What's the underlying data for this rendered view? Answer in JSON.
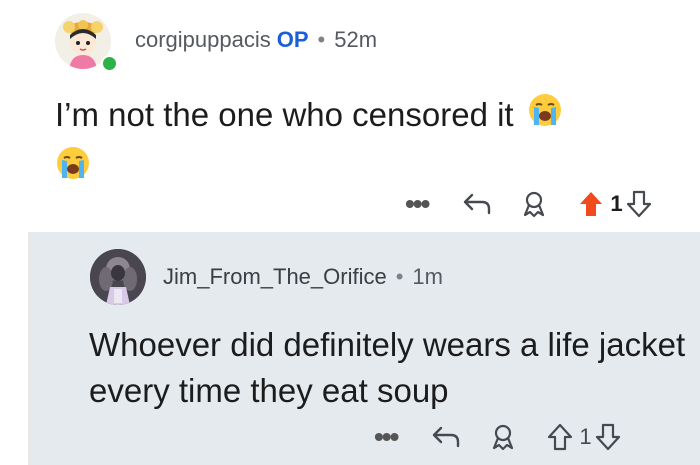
{
  "comment_op": {
    "author": "corgipuppacis",
    "flair": "OP",
    "separator": "•",
    "time": "52m",
    "body_line1": "I’m not the one who censored it",
    "emoji_name": "loudly-crying-face-emoji",
    "more_label": "•••",
    "vote_count": "1",
    "upvote_color": "#f14b1d"
  },
  "comment_reply": {
    "author": "Jim_From_The_Orifice",
    "separator": "•",
    "time": "1m",
    "body": "Whoever did definitely wears a life jacket every time they eat soup",
    "more_label": "•••",
    "vote_count": "1"
  },
  "colors": {
    "op_flair": "#1a5fd6",
    "online": "#2fb14a",
    "reply_background": "#e4eaee"
  }
}
